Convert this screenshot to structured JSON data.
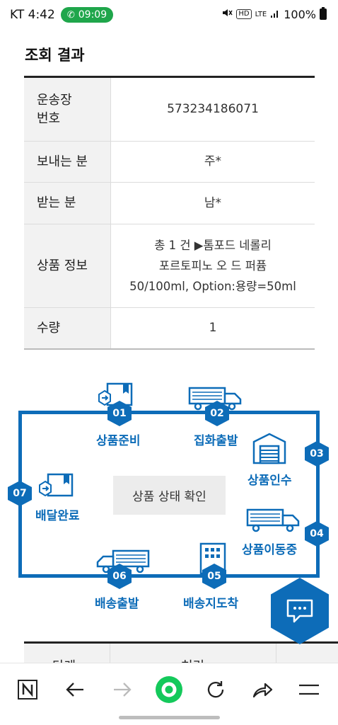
{
  "status_bar": {
    "carrier": "KT",
    "time": "4:42",
    "call_timer": "09:09",
    "network_hd": "HD",
    "network_lte": "LTE",
    "battery": "100%"
  },
  "result": {
    "title": "조회 결과",
    "rows": [
      {
        "label": "운송장\n번호",
        "value": "573234186071"
      },
      {
        "label": "보내는 분",
        "value": "주*"
      },
      {
        "label": "받는 분",
        "value": "남*"
      },
      {
        "label": "상품 정보",
        "value": "총 1 건 ▶톰포드 네롤리\n포르토피노 오 드 퍼퓸\n50/100ml, Option:용량=50ml"
      },
      {
        "label": "수량",
        "value": "1"
      }
    ]
  },
  "diagram": {
    "center_label": "상품 상태 확인",
    "steps": [
      {
        "num": "01",
        "label": "상품준비"
      },
      {
        "num": "02",
        "label": "집화출발"
      },
      {
        "num": "03",
        "label": "상품인수"
      },
      {
        "num": "04",
        "label": "상품이동중"
      },
      {
        "num": "05",
        "label": "배송지도착"
      },
      {
        "num": "06",
        "label": "배송출발"
      },
      {
        "num": "07",
        "label": "배달완료"
      }
    ],
    "accent_color": "#0d6cb8"
  },
  "history_table": {
    "col_stage": "단계",
    "col_process": "처리"
  },
  "chat_button": {
    "icon": "chat-icon"
  },
  "bottom_nav": {
    "items": [
      "naver-icon",
      "back-icon",
      "forward-icon",
      "home-icon",
      "refresh-icon",
      "share-icon",
      "menu-icon"
    ]
  }
}
